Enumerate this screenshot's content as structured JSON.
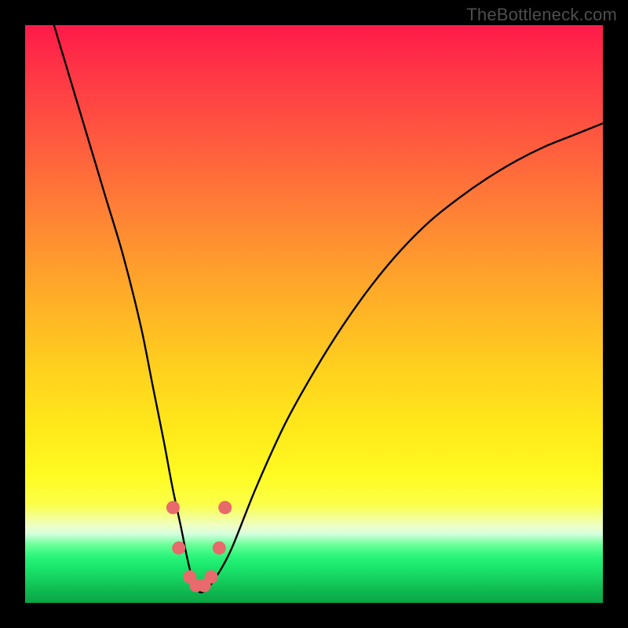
{
  "watermark": "TheBottleneck.com",
  "colors": {
    "background": "#000000",
    "watermark": "#4e4e4e",
    "curve": "#000000",
    "marker": "#e86a6c",
    "gradient_top": "#ff1a49",
    "gradient_mid": "#ffe91a",
    "gradient_bottom": "#0aa545"
  },
  "chart_data": {
    "type": "line",
    "title": "",
    "xlabel": "",
    "ylabel": "",
    "xlim": [
      0,
      100
    ],
    "ylim": [
      0,
      100
    ],
    "grid": false,
    "legend": false,
    "annotations": [
      "TheBottleneck.com"
    ],
    "series": [
      {
        "name": "bottleneck-curve",
        "x": [
          5,
          8,
          11,
          14,
          17,
          20,
          22,
          24,
          25.5,
          27,
          28,
          29,
          30,
          31,
          32,
          34,
          36,
          40,
          45,
          50,
          55,
          60,
          65,
          70,
          75,
          80,
          85,
          90,
          95,
          100
        ],
        "y": [
          100,
          90,
          80,
          70,
          60,
          48,
          38,
          28,
          20,
          13,
          8,
          4,
          2,
          2,
          3,
          6,
          10,
          20,
          31,
          40,
          48,
          55,
          61,
          66,
          70,
          73.5,
          76.5,
          79,
          81,
          83
        ]
      }
    ],
    "markers": [
      {
        "x": 25.6,
        "y": 16.5
      },
      {
        "x": 26.6,
        "y": 9.5
      },
      {
        "x": 28.5,
        "y": 4.5
      },
      {
        "x": 29.6,
        "y": 3.0
      },
      {
        "x": 31.0,
        "y": 3.0
      },
      {
        "x": 32.2,
        "y": 4.5
      },
      {
        "x": 33.6,
        "y": 9.5
      },
      {
        "x": 34.6,
        "y": 16.5
      }
    ]
  }
}
